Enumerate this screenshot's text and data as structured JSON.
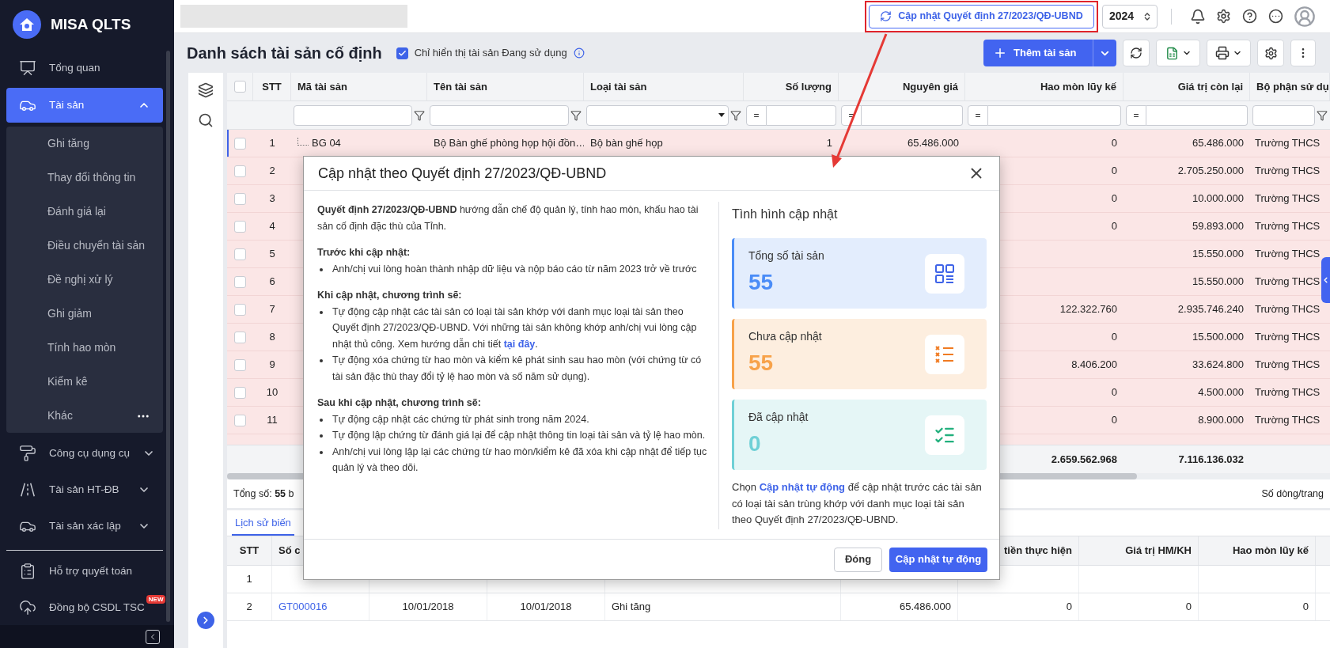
{
  "sidebar": {
    "app_name": "MISA QLTS",
    "groups": [
      [
        {
          "label": "Tổng quan",
          "selected": false
        },
        {
          "label": "Tài sản",
          "selected": true,
          "expanded": true,
          "children": [
            {
              "label": "Ghi tăng"
            },
            {
              "label": "Thay đổi thông tin"
            },
            {
              "label": "Đánh giá lại"
            },
            {
              "label": "Điều chuyển tài sản"
            },
            {
              "label": "Đề nghị xử lý"
            },
            {
              "label": "Ghi giảm"
            },
            {
              "label": "Tính hao mòn"
            },
            {
              "label": "Kiểm kê"
            },
            {
              "label": "Khác",
              "more": true
            }
          ]
        },
        {
          "label": "Công cụ dụng cụ",
          "selected": false,
          "expanded": false
        },
        {
          "label": "Tài sản HT-ĐB",
          "selected": false,
          "expanded": false
        },
        {
          "label": "Tài sản xác lập",
          "selected": false,
          "expanded": false
        }
      ],
      [
        {
          "label": "Hỗ trợ quyết toán",
          "selected": false
        },
        {
          "label": "Đồng bộ CSDL TSC",
          "selected": false,
          "badge": "NEW"
        }
      ]
    ]
  },
  "header": {
    "update_button": "Cập nhật Quyết định 27/2023/QĐ-UBND",
    "year": "2024"
  },
  "page": {
    "title": "Danh sách tài sản cố định",
    "active_only": {
      "label": "Chỉ hiển thị tài sản Đang sử dụng",
      "checked": true
    },
    "add_button": "Thêm tài sản"
  },
  "table": {
    "header_checked": false,
    "columns": [
      {
        "label": "STT"
      },
      {
        "label": "Mã tài sản",
        "filter": {
          "kind": "text"
        }
      },
      {
        "label": "Tên tài sản",
        "filter": {
          "kind": "text"
        }
      },
      {
        "label": "Loại tài sản",
        "filter": {
          "kind": "select"
        }
      },
      {
        "label": "Số lượng",
        "filter": {
          "kind": "number",
          "operator": "="
        }
      },
      {
        "label": "Nguyên giá",
        "filter": {
          "kind": "number",
          "operator": "="
        }
      },
      {
        "label": "Hao mòn lũy kế",
        "filter": {
          "kind": "number",
          "operator": "="
        }
      },
      {
        "label": "Giá trị còn lại",
        "filter": {
          "kind": "number",
          "operator": "="
        }
      },
      {
        "label": "Bộ phận sử dụ",
        "filter": {
          "kind": "text"
        }
      }
    ],
    "rows": [
      {
        "stt": "1",
        "code": "BG 04",
        "name": "Bộ Bàn ghế phòng họp hội đồn…",
        "type": "Bộ bàn ghế họp",
        "qty": "1",
        "cost": "65.486.000",
        "depreciation": "0",
        "remaining": "65.486.000",
        "department": "Trường THCS",
        "checked": false,
        "selected": true
      },
      {
        "stt": "2",
        "depreciation": "0",
        "remaining": "2.705.250.000",
        "department": "Trường THCS",
        "checked": false,
        "selected": false
      },
      {
        "stt": "3",
        "depreciation": "0",
        "remaining": "10.000.000",
        "department": "Trường THCS",
        "checked": false,
        "selected": false
      },
      {
        "stt": "4",
        "depreciation": "0",
        "remaining": "59.893.000",
        "department": "Trường THCS",
        "checked": false,
        "selected": false
      },
      {
        "stt": "5",
        "remaining": "15.550.000",
        "department": "Trường THCS",
        "checked": false,
        "selected": false
      },
      {
        "stt": "6",
        "remaining": "15.550.000",
        "department": "Trường THCS",
        "checked": false,
        "selected": false
      },
      {
        "stt": "7",
        "depreciation": "122.322.760",
        "remaining": "2.935.746.240",
        "department": "Trường THCS",
        "checked": false,
        "selected": false
      },
      {
        "stt": "8",
        "depreciation": "0",
        "remaining": "15.500.000",
        "department": "Trường THCS",
        "checked": false,
        "selected": false
      },
      {
        "stt": "9",
        "depreciation": "8.406.200",
        "remaining": "33.624.800",
        "department": "Trường THCS",
        "checked": false,
        "selected": false
      },
      {
        "stt": "10",
        "depreciation": "0",
        "remaining": "4.500.000",
        "department": "Trường THCS",
        "checked": false,
        "selected": false
      },
      {
        "stt": "11",
        "depreciation": "0",
        "remaining": "8.900.000",
        "department": "Trường THCS",
        "checked": false,
        "selected": false
      }
    ],
    "totals": {
      "depreciation": "2.659.562.968",
      "remaining": "7.116.136.032"
    },
    "total_label": "Tổng số: **55** b",
    "rows_per_page": "Số dòng/trang"
  },
  "bottom": {
    "tab": {
      "label": "Lịch sử biến",
      "selected": true
    },
    "header": {
      "stt": "STT",
      "voucher": "Số c",
      "amount": "tiền thực hiện",
      "rate_value": "Giá trị HM/KH",
      "accumulated": "Hao mòn lũy kế"
    },
    "rows": [
      {
        "stt": "1"
      },
      {
        "stt": "2",
        "voucher": "GT000016",
        "voucher_date": "10/01/2018",
        "record_date": "10/01/2018",
        "description": "Ghi tăng",
        "original_value": "65.486.000",
        "amount": "0",
        "rate_value": "0",
        "accumulated": "0"
      }
    ]
  },
  "dialog": {
    "title": "Cập nhật theo Quyết định 27/2023/QĐ-UBND",
    "intro": "**Quyết định 27/2023/QĐ-UBND** hướng dẫn chế độ quản lý, tính hao mòn, khấu hao tài sản cố định đặc thù của Tỉnh.",
    "sections": [
      {
        "heading": "Trước khi cập nhật:",
        "bullets": [
          {
            "text": "Anh/chị vui lòng hoàn thành nhập dữ liệu và nộp báo cáo từ năm 2023 trở về trước"
          }
        ]
      },
      {
        "heading": "Khi cập nhật, chương trình sẽ:",
        "bullets": [
          {
            "text": "Tự động cập nhật các tài sản có loại tài sản khớp với danh mục loại tài sản theo Quyết định 27/2023/QĐ-UBND. Với những tài sản không khớp anh/chị vui lòng cập nhật thủ công. Xem hướng dẫn chi tiết ",
            "link": "tại đây",
            "after": "."
          },
          {
            "text": "Tự động xóa chứng từ hao mòn và kiểm kê phát sinh sau hao mòn (với chứng từ có tài sản đặc thù thay đổi tỷ lệ hao mòn và số năm sử dụng)."
          }
        ]
      },
      {
        "heading": "Sau khi cập nhật, chương trình sẽ:",
        "bullets": [
          {
            "text": "Tự động cập nhật các chứng từ phát sinh trong năm 2024."
          },
          {
            "text": "Tự động lập chứng từ đánh giá lại để cập nhật thông tin loại tài sản và tỷ lệ hao mòn."
          },
          {
            "text": "Anh/chị vui lòng lập lại các chứng từ hao mòn/kiểm kê đã xóa khi cập nhật để tiếp tục quản lý và theo dõi."
          }
        ]
      }
    ],
    "status_title": "Tình hình cập nhật",
    "stats": [
      {
        "kind": "total",
        "label": "Tổng số tài sản",
        "value": "55"
      },
      {
        "kind": "pending",
        "label": "Chưa cập nhật",
        "value": "55"
      },
      {
        "kind": "done",
        "label": "Đã cập nhật",
        "value": "0"
      }
    ],
    "note": {
      "before": "Chọn ",
      "link": "Cập nhật tự động",
      "after": " để cập nhật trước các tài sản có loại tài sản trùng khớp với danh mục loại tài sản theo Quyết định 27/2023/QĐ-UBND."
    },
    "buttons": {
      "close": "Đóng",
      "confirm": "Cập nhật tự động"
    }
  }
}
